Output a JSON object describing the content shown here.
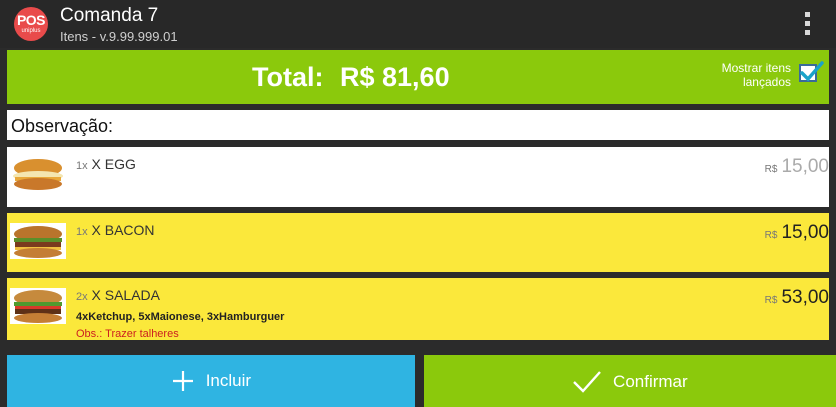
{
  "header": {
    "logo_text": "POS",
    "logo_sub": "uniplus",
    "title": "Comanda 7",
    "subtitle": "Itens - v.9.99.999.01"
  },
  "total": {
    "label": "Total:",
    "value": "R$ 81,60",
    "show_items_label": "Mostrar itens lançados",
    "show_items_checked": true
  },
  "observation": {
    "label": "Observação:"
  },
  "items": [
    {
      "qty": "1x",
      "name": "X EGG",
      "currency": "R$",
      "price": "15,00",
      "details": "",
      "obs": "",
      "style": "white"
    },
    {
      "qty": "1x",
      "name": "X BACON",
      "currency": "R$",
      "price": "15,00",
      "details": "",
      "obs": "",
      "style": "yellow"
    },
    {
      "qty": "2x",
      "name": "X SALADA",
      "currency": "R$",
      "price": "53,00",
      "details": "4xKetchup, 5xMaionese, 3xHamburguer",
      "obs": "Obs.: Trazer talheres",
      "style": "yellow"
    }
  ],
  "actions": {
    "include_label": "Incluir",
    "confirm_label": "Confirmar"
  },
  "colors": {
    "accent_green": "#8bc90c",
    "accent_blue": "#2fb4e2",
    "item_highlight": "#fbe83b",
    "logo_red": "#e94b4b"
  },
  "icons": [
    "menu-icon",
    "plus-icon",
    "check-icon",
    "burger-image"
  ]
}
